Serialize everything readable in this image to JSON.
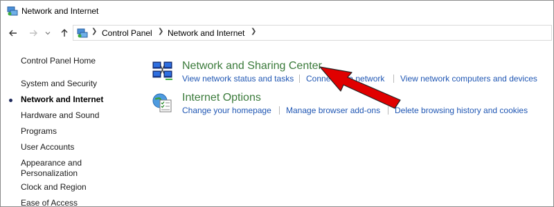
{
  "window": {
    "title": "Network and Internet"
  },
  "nav": {
    "back_icon": "back-arrow",
    "forward_icon": "forward-arrow",
    "recent_icon": "dropdown-chevron",
    "up_icon": "up-arrow"
  },
  "address": {
    "crumbs": [
      "Control Panel",
      "Network and Internet"
    ]
  },
  "sidebar": {
    "items": [
      {
        "label": "Control Panel Home"
      },
      {
        "label": "System and Security"
      },
      {
        "label": "Network and Internet",
        "active": true
      },
      {
        "label": "Hardware and Sound"
      },
      {
        "label": "Programs"
      },
      {
        "label": "User Accounts"
      },
      {
        "label": "Appearance and Personalization"
      },
      {
        "label": "Clock and Region"
      },
      {
        "label": "Ease of Access"
      }
    ]
  },
  "categories": [
    {
      "title": "Network and Sharing Center",
      "icon": "network-sharing-icon",
      "links": [
        "View network status and tasks",
        "Connect to a network",
        "View network computers and devices"
      ]
    },
    {
      "title": "Internet Options",
      "icon": "internet-options-icon",
      "links": [
        "Change your homepage",
        "Manage browser add-ons",
        "Delete browsing history and cookies"
      ]
    }
  ],
  "colors": {
    "category_title": "#3a7a3a",
    "link": "#1f56b3",
    "arrow": "#e00000"
  }
}
